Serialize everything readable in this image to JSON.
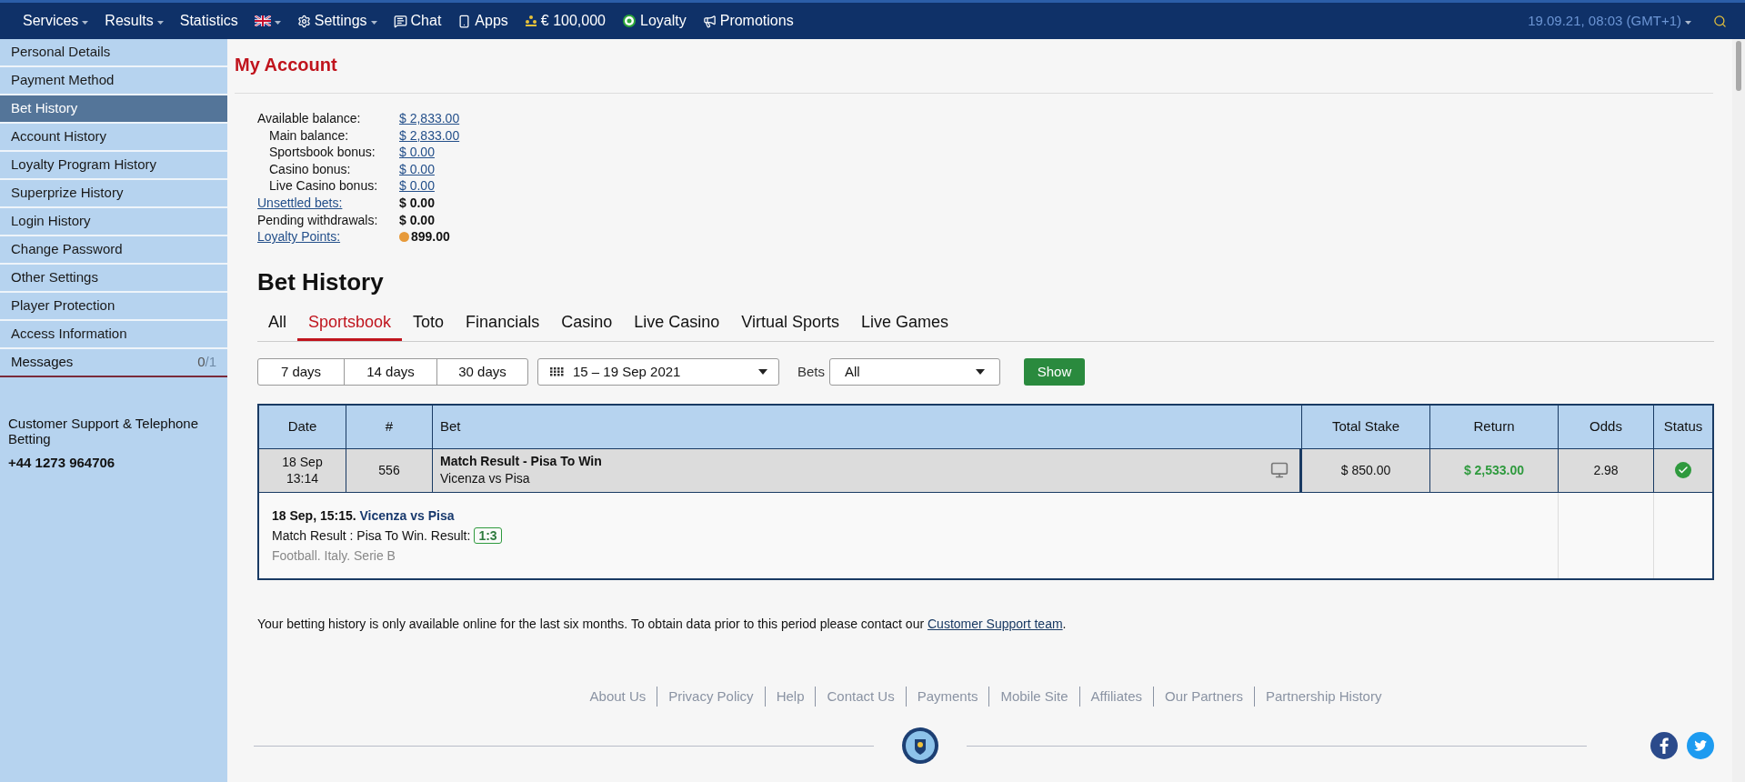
{
  "nav": {
    "items": [
      {
        "label": "Services",
        "kind": "text",
        "dropdown": true
      },
      {
        "label": "Results",
        "kind": "text",
        "dropdown": true
      },
      {
        "label": "Statistics",
        "kind": "text",
        "dropdown": false
      },
      {
        "kind": "flag",
        "dropdown": true
      },
      {
        "label": "Settings",
        "kind": "gear",
        "dropdown": true
      },
      {
        "label": "Chat",
        "kind": "chat",
        "dropdown": false
      },
      {
        "label": "Apps",
        "kind": "phone",
        "dropdown": false
      },
      {
        "label": "€ 100,000",
        "kind": "coins",
        "dropdown": false
      },
      {
        "label": "Loyalty",
        "kind": "loyalty",
        "dropdown": false
      },
      {
        "label": "Promotions",
        "kind": "megaphone",
        "dropdown": false
      }
    ],
    "datetime": "19.09.21, 08:03 (GMT+1)"
  },
  "sidebar": {
    "items": [
      {
        "label": "Personal Details",
        "selected": false
      },
      {
        "label": "Payment Method",
        "selected": false
      },
      {
        "label": "Bet History",
        "selected": true
      },
      {
        "label": "Account History",
        "selected": false
      },
      {
        "label": "Loyalty Program History",
        "selected": false
      },
      {
        "label": "Superprize History",
        "selected": false
      },
      {
        "label": "Login History",
        "selected": false
      },
      {
        "label": "Change Password",
        "selected": false
      },
      {
        "label": "Other Settings",
        "selected": false
      },
      {
        "label": "Player Protection",
        "selected": false
      },
      {
        "label": "Access Information",
        "selected": false
      }
    ],
    "messages": {
      "label": "Messages",
      "unread": "0",
      "total": "/1"
    },
    "support": {
      "title": "Customer Support & Telephone Betting",
      "phone": "+44 1273 964706"
    }
  },
  "page_title": "My Account",
  "balances": [
    {
      "label": "Available balance:",
      "value": "$ 2,833.00",
      "kind": "link-value",
      "indent": false
    },
    {
      "label": "Main balance:",
      "value": "$ 2,833.00",
      "kind": "link-value",
      "indent": true
    },
    {
      "label": "Sportsbook bonus:",
      "value": "$ 0.00",
      "kind": "link-value",
      "indent": true
    },
    {
      "label": "Casino bonus:",
      "value": "$ 0.00",
      "kind": "link-value",
      "indent": true
    },
    {
      "label": "Live Casino bonus:",
      "value": "$ 0.00",
      "kind": "link-value",
      "indent": true
    },
    {
      "label": "Unsettled bets:",
      "value": "$ 0.00",
      "kind": "link-label",
      "indent": false
    },
    {
      "label": "Pending withdrawals:",
      "value": "$ 0.00",
      "kind": "plain",
      "indent": false
    },
    {
      "label": "Loyalty Points:",
      "value": "899.00",
      "kind": "points",
      "indent": false
    }
  ],
  "section_title": "Bet History",
  "tabs": [
    {
      "label": "All",
      "selected": false
    },
    {
      "label": "Sportsbook",
      "selected": true
    },
    {
      "label": "Toto",
      "selected": false
    },
    {
      "label": "Financials",
      "selected": false
    },
    {
      "label": "Casino",
      "selected": false
    },
    {
      "label": "Live Casino",
      "selected": false
    },
    {
      "label": "Virtual Sports",
      "selected": false
    },
    {
      "label": "Live Games",
      "selected": false
    }
  ],
  "filters": {
    "periods": [
      "7 days",
      "14 days",
      "30 days"
    ],
    "date_range": "15 – 19 Sep 2021",
    "bets_label": "Bets",
    "bets_value": "All",
    "show_button": "Show"
  },
  "table": {
    "columns": [
      "Date",
      "#",
      "Bet",
      "Total Stake",
      "Return",
      "Odds",
      "Status"
    ],
    "rows": [
      {
        "date": "18 Sep",
        "time": "13:14",
        "number": "556",
        "market": "Match Result - Pisa To Win",
        "event": "Vicenza vs Pisa",
        "stake": "$ 850.00",
        "return": "$ 2,533.00",
        "odds": "2.98",
        "kind": "won",
        "details": {
          "when": "18 Sep, 15:15.",
          "event": "Vicenza vs Pisa",
          "line": "Match Result : Pisa To Win. Result:",
          "result": "1:3",
          "league": "Football. Italy. Serie B"
        }
      }
    ]
  },
  "notice": {
    "text": "Your betting history is only available online for the last six months. To obtain data prior to this period please contact our",
    "link": "Customer Support team",
    "end": "."
  },
  "footer_links": [
    "About Us",
    "Privacy Policy",
    "Help",
    "Contact Us",
    "Payments",
    "Mobile Site",
    "Affiliates",
    "Our Partners",
    "Partnership History"
  ]
}
